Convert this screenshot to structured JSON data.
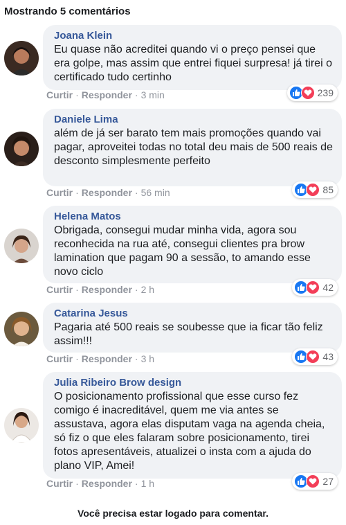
{
  "header": {
    "title": "Mostrando 5 comentários"
  },
  "actions": {
    "like_label": "Curtir",
    "reply_label": "Responder",
    "separator": "·"
  },
  "comments": [
    {
      "author": "Joana Klein",
      "text": "Eu quase não acreditei quando vi o preço pensei que era golpe, mas assim que entrei fiquei surpresa! já tirei o certificado tudo certinho",
      "time": "3 min",
      "reactions": "239"
    },
    {
      "author": "Daniele Lima",
      "text": "além de já ser barato tem mais promoções quando vai pagar, aproveitei todas no total deu mais de 500 reais de desconto simplesmente perfeito",
      "time": "56 min",
      "reactions": "85"
    },
    {
      "author": "Helena Matos",
      "text": "Obrigada, consegui mudar minha vida, agora sou reconhecida na rua até, consegui clientes pra brow lamination que pagam 90 a sessão, to amando esse novo ciclo",
      "time": "2 h",
      "reactions": "42"
    },
    {
      "author": "Catarina Jesus",
      "text": "Pagaria até 500 reais se soubesse que ia ficar tão feliz assim!!!",
      "time": "3 h",
      "reactions": "43"
    },
    {
      "author": "Julia Ribeiro Brow design",
      "text": "O posicionamento profissional que esse curso fez comigo é inacreditável, quem me via antes se assustava, agora elas disputam vaga na agenda cheia, só fiz o que eles falaram sobre posicionamento, tirei fotos apresentáveis, atualizei o insta com a ajuda do plano VIP, Amei!",
      "time": "1 h",
      "reactions": "27"
    }
  ],
  "footer": {
    "text": "Você precisa estar logado para comentar."
  },
  "colors": {
    "author": "#365899",
    "bubble": "#f0f2f5",
    "like": "#1877f2",
    "love": "#f33e58",
    "muted": "#90949c"
  }
}
